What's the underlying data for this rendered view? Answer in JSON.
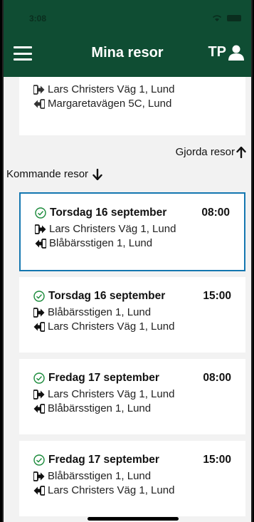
{
  "status": {
    "time": "3:08"
  },
  "header": {
    "title": "Mina resor",
    "user_initials": "TP"
  },
  "past_trip": {
    "from": "Lars Christers Väg 1, Lund",
    "to": "Margaretavägen 5C, Lund"
  },
  "links": {
    "done_trips": "Gjorda resor",
    "upcoming_trips": "Kommande resor"
  },
  "trips": [
    {
      "day": "Torsdag 16 september",
      "time": "08:00",
      "from": "Lars Christers Väg 1, Lund",
      "to": "Blåbärsstigen 1, Lund"
    },
    {
      "day": "Torsdag 16 september",
      "time": "15:00",
      "from": "Blåbärsstigen 1, Lund",
      "to": "Lars Christers Väg 1, Lund"
    },
    {
      "day": "Fredag 17 september",
      "time": "08:00",
      "from": "Lars Christers Väg 1, Lund",
      "to": "Blåbärsstigen 1, Lund"
    },
    {
      "day": "Fredag 17 september",
      "time": "15:00",
      "from": "Blåbärsstigen 1, Lund",
      "to": "Lars Christers Väg 1, Lund"
    }
  ],
  "colors": {
    "header": "#0f4d33",
    "selected_border": "#1477b0",
    "check": "#1a8a3a"
  },
  "icons": [
    "menu-icon",
    "user-icon",
    "check-circle-icon",
    "depart-arrow-icon",
    "arrive-arrow-icon",
    "arrow-up-icon",
    "arrow-down-icon"
  ]
}
